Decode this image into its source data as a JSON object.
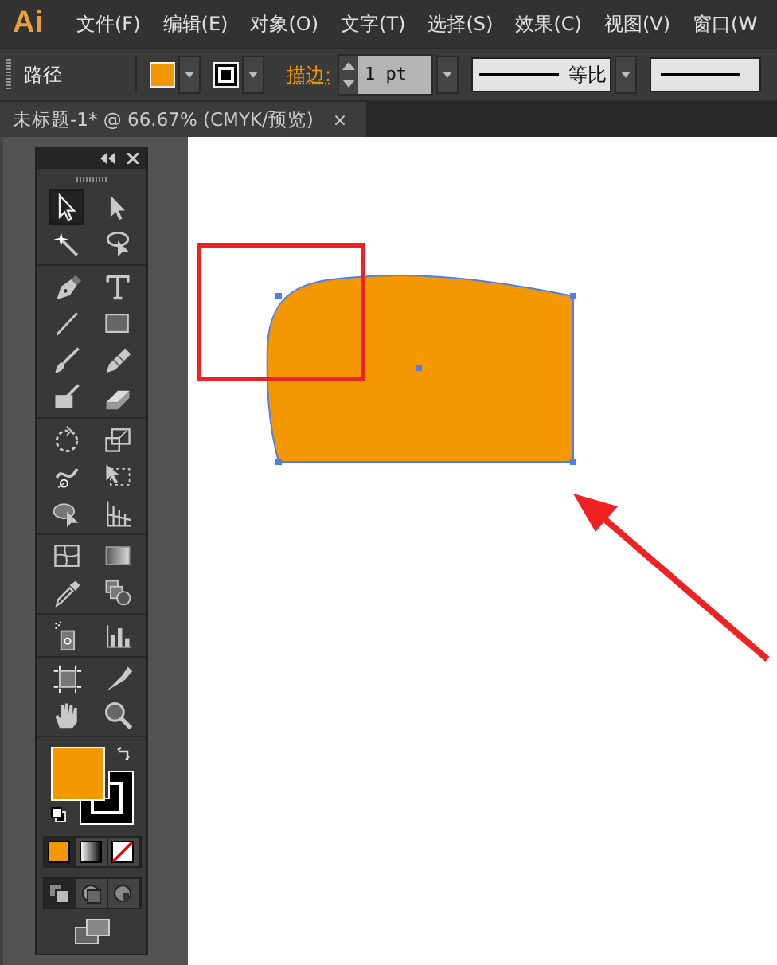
{
  "menu_bar": {
    "logo": "Ai",
    "items": [
      "文件(F)",
      "编辑(E)",
      "对象(O)",
      "文字(T)",
      "选择(S)",
      "效果(C)",
      "视图(V)",
      "窗口(W"
    ]
  },
  "control_bar": {
    "label": "路径",
    "stroke_label": "描边:",
    "stroke_weight": "1 pt",
    "profile": "等比"
  },
  "document_tab": {
    "title": "未标题-1* @ 66.67% (CMYK/预览)",
    "close": "×"
  },
  "tools_panel": {
    "groups": [
      [
        {
          "kind": "selection",
          "selected": true
        },
        {
          "kind": "direct-selection",
          "selected": false
        },
        {
          "kind": "magic-wand",
          "selected": false
        },
        {
          "kind": "lasso",
          "selected": false
        }
      ],
      [
        {
          "kind": "pen",
          "selected": false
        },
        {
          "kind": "type",
          "selected": false
        },
        {
          "kind": "line",
          "selected": false
        },
        {
          "kind": "rectangle",
          "selected": false
        },
        {
          "kind": "paintbrush",
          "selected": false
        },
        {
          "kind": "pencil",
          "selected": false
        },
        {
          "kind": "blob-brush",
          "selected": false
        },
        {
          "kind": "eraser",
          "selected": false
        }
      ],
      [
        {
          "kind": "rotate",
          "selected": false
        },
        {
          "kind": "scale",
          "selected": false
        },
        {
          "kind": "warp",
          "selected": false
        },
        {
          "kind": "free-transform",
          "selected": false
        },
        {
          "kind": "shape-builder",
          "selected": false
        },
        {
          "kind": "perspective-grid",
          "selected": false
        }
      ],
      [
        {
          "kind": "mesh",
          "selected": false
        },
        {
          "kind": "gradient",
          "selected": false
        },
        {
          "kind": "eyedropper",
          "selected": false
        },
        {
          "kind": "blend",
          "selected": false
        }
      ],
      [
        {
          "kind": "symbol-sprayer",
          "selected": false
        },
        {
          "kind": "column-graph",
          "selected": false
        }
      ],
      [
        {
          "kind": "artboard",
          "selected": false
        },
        {
          "kind": "slice",
          "selected": false
        },
        {
          "kind": "hand",
          "selected": false
        },
        {
          "kind": "zoom",
          "selected": false
        }
      ]
    ],
    "color_modes": [
      {
        "kind": "color",
        "selected": true
      },
      {
        "kind": "gradient",
        "selected": false
      },
      {
        "kind": "none",
        "selected": false
      }
    ],
    "draw_modes": [
      {
        "kind": "normal",
        "selected": true
      },
      {
        "kind": "behind",
        "selected": false
      },
      {
        "kind": "inside",
        "selected": false
      }
    ]
  }
}
